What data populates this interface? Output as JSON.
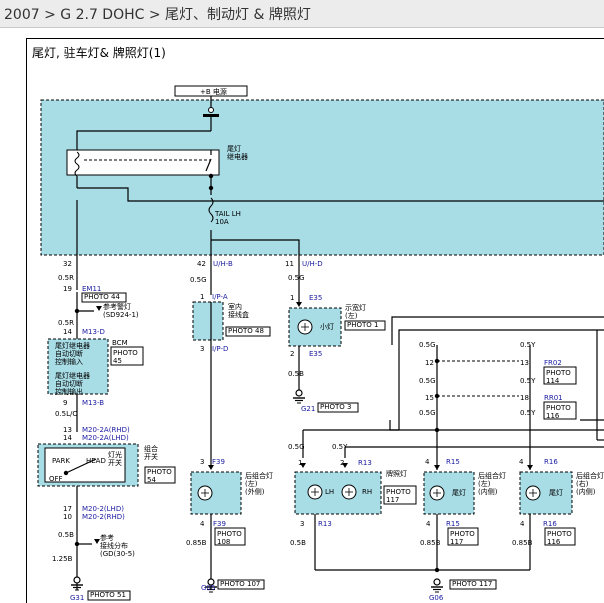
{
  "breadcrumb": {
    "model": "2007",
    "sep": ">",
    "engine": "G 2.7 DOHC",
    "section": "尾灯、制动灯 & 牌照灯"
  },
  "diagram": {
    "title": "尾灯, 驻车灯&  牌照灯(1)",
    "power": "+B 电源",
    "relay": [
      "尾灯",
      "继电器"
    ],
    "fuse": [
      "TAIL LH",
      "10A"
    ],
    "colors": {
      "fuse_box_fill": "#a8dde6",
      "module_fill": "#a8dde6",
      "wire": "#000000",
      "connector_blue": "#1a1aa0"
    },
    "conn_labels": {
      "pin32": "32",
      "pin42": "42",
      "pin11": "11",
      "conn_uhb": "U/H-B",
      "conn_uhd": "U/H-D",
      "w05r_1": "0.5R",
      "w05g_1": "0.5G",
      "w05g_2": "0.5G",
      "pin19": "19",
      "em11": "EM11",
      "photo44": "PHOTO 44",
      "ref_title": "参考警灯",
      "ref_code": "(SD924-1)",
      "w05r_2": "0.5R",
      "pin14a": "14",
      "m13d": "M13-D",
      "bcm": "BCM",
      "photo45_a": "PHOTO",
      "photo45_b": "45",
      "bcm_text1": [
        "尾灯继电器",
        "自动切断",
        "控制输入"
      ],
      "bcm_text2": [
        "尾灯继电器",
        "自动切断",
        "控制输出"
      ],
      "pin9": "9",
      "m13b": "M13-B",
      "w05lo": "0.5L/O",
      "pin13": "13",
      "m20_2a_rhd": "M20-2A(RHD)",
      "pin14b": "14",
      "m20_2a_lhd": "M20-2A(LHD)",
      "sw_park": "PARK",
      "sw_head": "HEAD",
      "sw_off": "OFF",
      "sw_name1": "组合",
      "sw_name2": "开关",
      "sw_lamp1": "灯光",
      "sw_lamp2": "开关",
      "photo54_a": "PHOTO",
      "photo54_b": "54",
      "pin17": "17",
      "m20_2_lhd": "M20-2(LHD)",
      "pin10": "10",
      "m20_2_rhd": "M20-2(RHD)",
      "w05b_a": "0.5B",
      "ref2_title": "参考",
      "ref2_sub": "接线分布",
      "ref2_code": "(GD(30-5)",
      "w125b": "1.25B",
      "g31": "G31",
      "photo51": "PHOTO 51",
      "pin1_ipa": "1",
      "ipa": "I/P-A",
      "mid_conn": [
        "室内",
        "接线盒"
      ],
      "photo48": "PHOTO 48",
      "pin3_ipd": "3",
      "ipd": "I/P-D",
      "pin3_f39": "3",
      "f39": "F39",
      "tail_lf": [
        "后组合灯",
        "(左)",
        "(外侧)"
      ],
      "pin4_f39": "4",
      "f39b": "F39",
      "photo108": [
        "PHOTO",
        "108"
      ],
      "w085b_a": "0.85B",
      "g05": "G05",
      "photo107": "PHOTO 107",
      "pin1_e35": "1",
      "e35": "E35",
      "small_lamp": "小灯",
      "side_lamp": [
        "示宽灯",
        "(左)"
      ],
      "photo1": "PHOTO 1",
      "pin2_e35": "2",
      "e35b": "E35",
      "w05b_b": "0.5B",
      "g21": "G21",
      "photo3": "PHOTO 3",
      "w05g_r13": "0.5G",
      "w05y_r13": "0.5Y",
      "pin1_r13": "1",
      "pin2_r13": "2",
      "r13": "R13",
      "lic": "牌照灯",
      "lh": "LH",
      "rh": "RH",
      "photo117_a": [
        "PHOTO",
        "117"
      ],
      "pin3_r13": "3",
      "r13b": "R13",
      "w05b_r13": "0.5B",
      "w05g_a": "0.5G",
      "pin12": "12",
      "w05g_b": "0.5G",
      "pin15": "15",
      "w05g_c": "0.5G",
      "pin4_r15": "4",
      "r15": "R15",
      "tail_li": [
        "后组合灯",
        "(左)",
        "(内侧)"
      ],
      "pin4_r15b": "4",
      "r15b": "R15",
      "photo117_b": [
        "PHOTO",
        "117"
      ],
      "w085b_b": "0.85B",
      "g06": "G06",
      "photo117_c": "PHOTO 117",
      "w05y_a": "0.5Y",
      "pin13b": "13",
      "fr02": "FR02",
      "photo114": [
        "PHOTO",
        "114"
      ],
      "w05y_b": "0.5Y",
      "pin18": "18",
      "rr01": "RR01",
      "photo116": [
        "PHOTO",
        "116"
      ],
      "w05y_c": "0.5Y",
      "pin4_r16": "4",
      "r16": "R16",
      "tail_ri": [
        "后组合灯",
        "(右)",
        "(内侧)"
      ],
      "pin4_r16b": "4",
      "r16b": "R16",
      "photo116b": [
        "PHOTO",
        "116"
      ],
      "w085b_c": "0.85B",
      "tail_sym": "尾灯"
    }
  }
}
